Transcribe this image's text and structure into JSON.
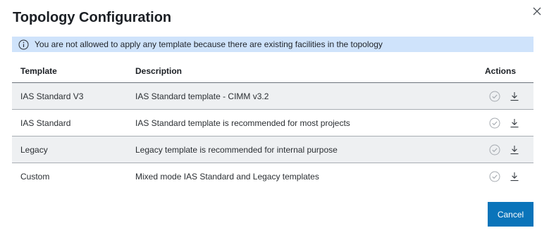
{
  "dialog": {
    "title": "Topology Configuration",
    "close_icon": "close-icon"
  },
  "banner": {
    "icon": "info-icon",
    "message": "You are not allowed to apply any template because there are existing facilities in the topology",
    "background": "#cfe3fb"
  },
  "table": {
    "headers": {
      "template": "Template",
      "description": "Description",
      "actions": "Actions"
    },
    "rows": [
      {
        "template": "IAS Standard V3",
        "description": "IAS Standard template - CIMM v3.2"
      },
      {
        "template": "IAS Standard",
        "description": "IAS Standard template is recommended for most projects"
      },
      {
        "template": "Legacy",
        "description": "Legacy template is recommended for internal purpose"
      },
      {
        "template": "Custom",
        "description": "Mixed mode IAS Standard and Legacy templates"
      }
    ],
    "row_actions": [
      "apply-check-icon",
      "download-icon"
    ]
  },
  "footer": {
    "cancel_label": "Cancel",
    "accent": "#0a74ba"
  }
}
